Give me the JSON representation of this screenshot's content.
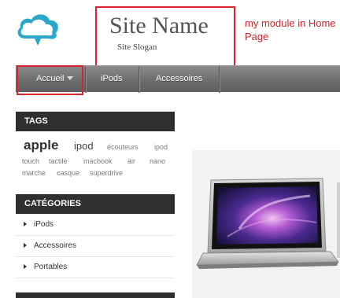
{
  "header": {
    "site_name": "Site Name",
    "site_slogan": "Site Slogan",
    "annotation": "my module in Home Page"
  },
  "nav": {
    "items": [
      {
        "label": "Accueil",
        "has_dropdown": true
      },
      {
        "label": "iPods"
      },
      {
        "label": "Accessoires"
      }
    ]
  },
  "tags": {
    "title": "TAGS",
    "items": [
      "apple",
      "ipod",
      "écouteurs",
      "ipod",
      "touch",
      "tactile",
      "macbook",
      "air",
      "nano",
      "marche",
      "casque",
      "superdrive"
    ]
  },
  "categories": {
    "title": "CATÉGORIES",
    "items": [
      {
        "label": "iPods"
      },
      {
        "label": "Accessoires"
      },
      {
        "label": "Portables"
      }
    ]
  },
  "colors": {
    "accent_red": "#d9232d",
    "logo_blue": "#2aa7c9",
    "nav_bg": "#6e6e6e",
    "block_title_bg": "#2f2f2f"
  },
  "icons": {
    "logo": "cloud-chat-icon",
    "dropdown": "caret-down-icon",
    "list_bullet": "triangle-right-icon"
  }
}
